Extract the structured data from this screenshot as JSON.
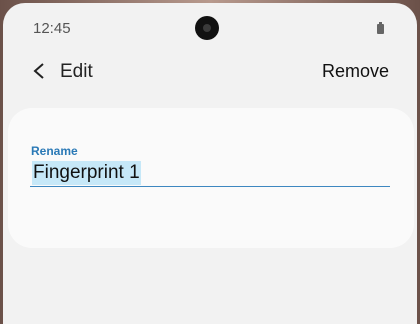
{
  "status_bar": {
    "time": "12:45",
    "camera_icon": "front-camera-icon",
    "battery_icon": "battery-icon"
  },
  "app_bar": {
    "back_icon": "back-arrow-icon",
    "title": "Edit",
    "remove_label": "Remove"
  },
  "form": {
    "field_label": "Rename",
    "value": "Fingerprint 1",
    "selection": "all",
    "colors": {
      "accent": "#2a79b6",
      "selection_highlight": "#c6e8f8"
    }
  }
}
